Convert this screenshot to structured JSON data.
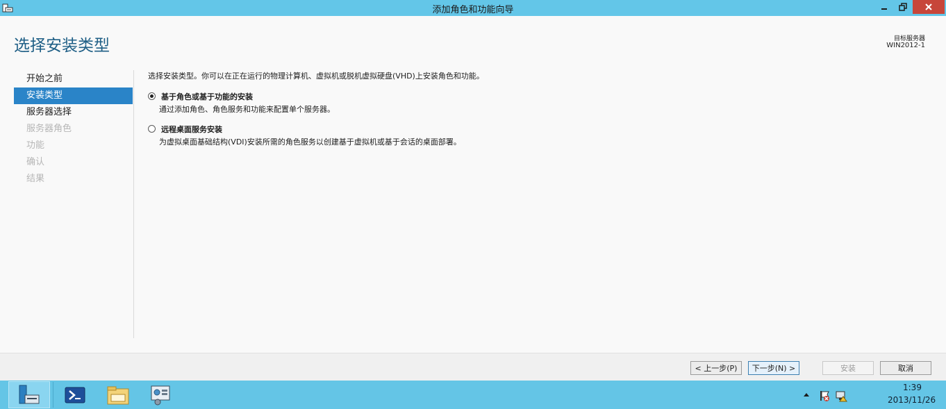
{
  "window": {
    "title": "添加角色和功能向导"
  },
  "header": {
    "page_title": "选择安装类型",
    "destination_label": "目标服务器",
    "destination_server": "WIN2012-1"
  },
  "nav": {
    "items": [
      {
        "label": "开始之前",
        "state": "normal"
      },
      {
        "label": "安装类型",
        "state": "selected"
      },
      {
        "label": "服务器选择",
        "state": "normal"
      },
      {
        "label": "服务器角色",
        "state": "disabled"
      },
      {
        "label": "功能",
        "state": "disabled"
      },
      {
        "label": "确认",
        "state": "disabled"
      },
      {
        "label": "结果",
        "state": "disabled"
      }
    ]
  },
  "main": {
    "intro": "选择安装类型。你可以在正在运行的物理计算机、虚拟机或脱机虚拟硬盘(VHD)上安装角色和功能。",
    "options": [
      {
        "label": "基于角色或基于功能的安装",
        "description": "通过添加角色、角色服务和功能来配置单个服务器。",
        "checked": true
      },
      {
        "label": "远程桌面服务安装",
        "description": "为虚拟桌面基础结构(VDI)安装所需的角色服务以创建基于虚拟机或基于会话的桌面部署。",
        "checked": false
      }
    ]
  },
  "buttons": {
    "prev": "< 上一步(P)",
    "next": "下一步(N) >",
    "install": "安装",
    "cancel": "取消"
  },
  "taskbar": {
    "time": "1:39",
    "date": "2013/11/26"
  },
  "colors": {
    "titlebar": "#63c6e8",
    "accent": "#2a84c8",
    "close_button": "#c7463a",
    "taskbar": "#64c5e6"
  }
}
